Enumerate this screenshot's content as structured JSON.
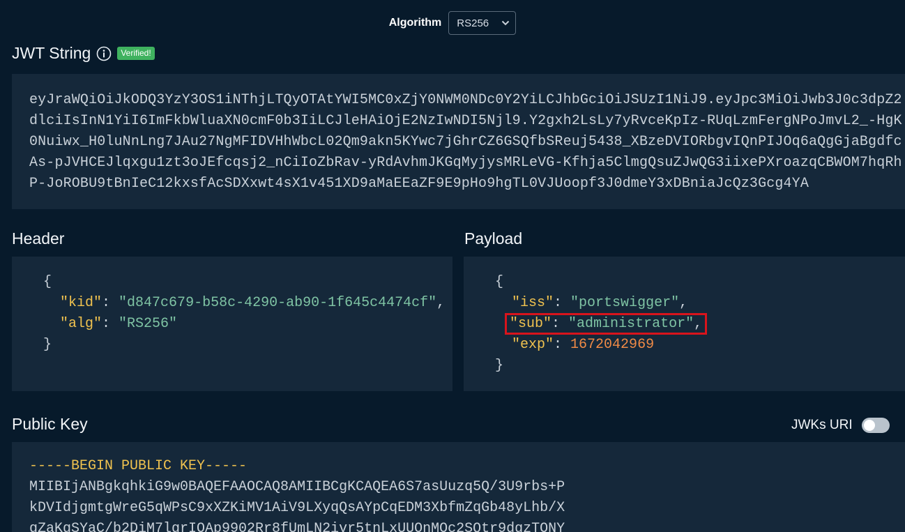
{
  "algorithm": {
    "label": "Algorithm",
    "selected": "RS256"
  },
  "jwt": {
    "title": "JWT String",
    "badge": "Verified!",
    "lines": [
      "eyJraWQiOiJkODQ3YzY3OS1iNThjLTQyOTAtYWI5MC0xZjY0NWM0NDc0Y2YiLCJhbGciOiJSUzI1NiJ9.eyJpc3MiOiJwb3J0c3dpZ2",
      "dlciIsInN1YiI6ImFkbWluaXN0cmF0b3IiLCJleHAiOjE2NzIwNDI5Njl9.Y2gxh2LsLy7yRvceKpIz-RUqLzmFergNPoJmvL2_-HgK",
      "0Nuiwx_H0luNnLng7JAu27NgMFIDVHhWbcL02Qm9akn5KYwc7jGhrCZ6GSQfbSReuj5438_XBzeDVIORbgvIQnPIJOq6aQgGjaBgdfc",
      "As-pJVHCEJlqxgu1zt3oJEfcqsj2_nCiIoZbRav-yRdAvhmJKGqMyjysMRLeVG-Kfhja5ClmgQsuZJwQG3iixePXroazqCBWOM7hqRh",
      "P-JoROBU9tBnIeC12kxsfAcSDXxwt4sX1v451XD9aMaEEaZF9E9pHo9hgTL0VJUoopf3J0dmeY3xDBniaJcQz3Gcg4YA"
    ]
  },
  "header": {
    "title": "Header",
    "open": "{",
    "close": "}",
    "kid_key": "\"kid\"",
    "kid_value": "\"d847c679-b58c-4290-ab90-1f645c4474cf\"",
    "alg_key": "\"alg\"",
    "alg_value": "\"RS256\""
  },
  "payload": {
    "title": "Payload",
    "open": "{",
    "close": "}",
    "iss_key": "\"iss\"",
    "iss_value": "\"portswigger\"",
    "sub_key": "\"sub\"",
    "sub_value": "\"administrator\"",
    "exp_key": "\"exp\"",
    "exp_value": "1672042969"
  },
  "public_key": {
    "title": "Public Key",
    "jwks_label": "JWKs URI",
    "jwks_enabled": false,
    "lines": [
      "-----BEGIN PUBLIC KEY-----",
      "MIIBIjANBgkqhkiG9w0BAQEFAAOCAQ8AMIIBCgKCAQEA6S7asUuzq5Q/3U9rbs+P",
      "kDVIdjgmtgWreG5qWPsC9xXZKiMV1AiV9LXyqQsAYpCqEDM3XbfmZqGb48yLhb/X",
      "gZaKgSYaC/b2DiM7lgrIOAp9902Rr8fUmLN2ivr5tnLxUUOnMOc2SQtr9dgzTONY"
    ]
  },
  "colors": {
    "background": "#071a2b",
    "panel": "#15283a",
    "key": "#f0c24f",
    "string": "#7fc4a4",
    "number": "#ef8a46",
    "badge": "#3fb25f",
    "highlight": "#d8141c"
  },
  "icons": {
    "info": "info-circle-icon",
    "dropdown": "chevron-down-icon"
  }
}
